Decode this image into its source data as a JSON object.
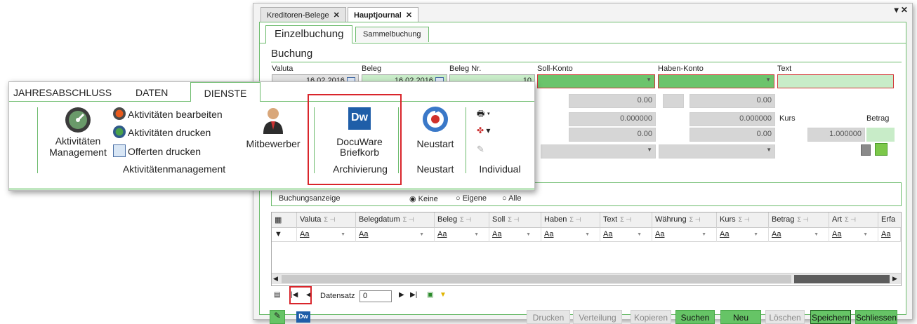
{
  "window": {
    "tabs": [
      {
        "label": "Kreditoren-Belege",
        "close": "✕"
      },
      {
        "label": "Hauptjournal",
        "close": "✕"
      }
    ],
    "controls": "▾ ✕"
  },
  "form": {
    "subtabs": [
      "Einzelbuchung",
      "Sammelbuchung"
    ],
    "section_title": "Buchung",
    "labels": {
      "valuta": "Valuta",
      "beleg": "Beleg",
      "beleg_nr": "Beleg Nr.",
      "soll_konto": "Soll-Konto",
      "haben_konto": "Haben-Konto",
      "text": "Text",
      "kurs": "Kurs",
      "betrag": "Betrag"
    },
    "values": {
      "valuta": "16.02.2016",
      "beleg": "16.02.2016",
      "beleg_nr": "10",
      "row1_a": "0.00",
      "row1_b": "0.00",
      "row2_a": "0.000000",
      "row2_b": "0.000000",
      "row3_a": "0.00",
      "row3_b": "0.00",
      "kurs_value": "1.000000"
    },
    "buchungsanzeige": {
      "label": "Buchungsanzeige",
      "options": [
        "Keine",
        "Eigene",
        "Alle"
      ]
    }
  },
  "grid": {
    "columns": [
      "Valuta",
      "Belegdatum",
      "Beleg",
      "Soll",
      "Haben",
      "Text",
      "Währung",
      "Kurs",
      "Betrag",
      "Art",
      "Erfa"
    ],
    "filter_text": "Aa",
    "sigma": "Σ ⊣"
  },
  "navigator": {
    "label": "Datensatz",
    "value": "0"
  },
  "buttons": {
    "drucken": "Drucken",
    "verteilung": "Verteilung",
    "kopieren": "Kopieren",
    "suchen": "Suchen",
    "neu": "Neu",
    "loeschen": "Löschen",
    "speichern": "Speichern",
    "schliessen": "Schliessen"
  },
  "ribbon": {
    "tabs": [
      "JAHRESABSCHLUSS",
      "DATEN",
      "DIENSTE"
    ],
    "active_tab": "DIENSTE",
    "big_buttons": {
      "aktivitaeten_management": "Aktivitäten\nManagement",
      "mitbewerber": "Mitbewerber",
      "docuware": "DocuWare\nBriefkorb",
      "neustart": "Neustart"
    },
    "small_buttons": [
      "Aktivitäten bearbeiten",
      "Aktivitäten drucken",
      "Offerten drucken"
    ],
    "groups": [
      "Aktivitätenmanagement",
      "Archivierung",
      "Neustart",
      "Individual"
    ],
    "docuware_icon_text": "Dw",
    "highlight_color": "#d9252b",
    "accent_green": "#6cbb6c"
  }
}
